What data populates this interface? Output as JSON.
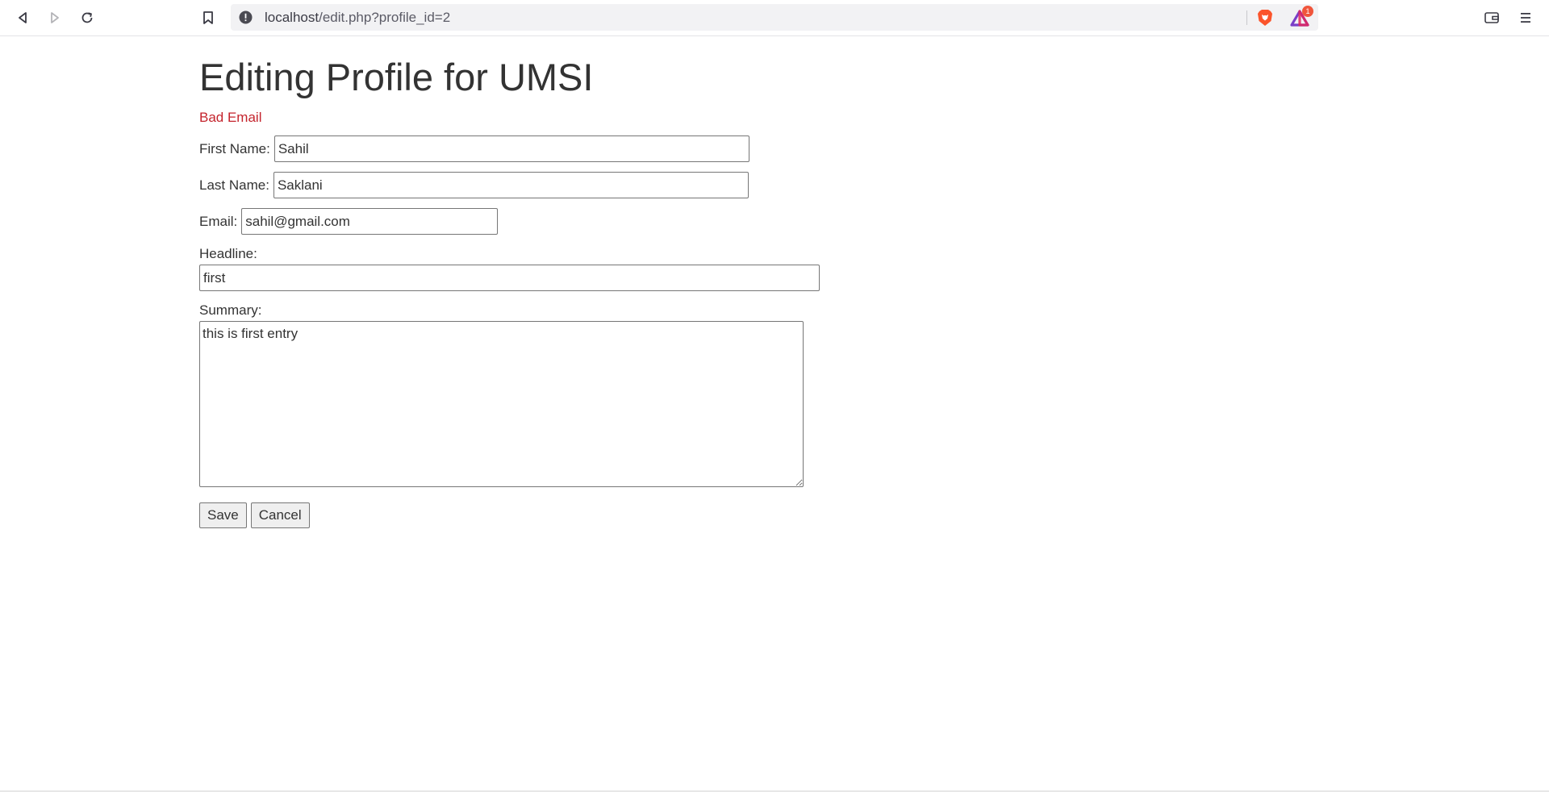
{
  "browser": {
    "url_host": "localhost",
    "url_path": "/edit.php?profile_id=2",
    "rewards_badge": "1",
    "icons": {
      "back": "back-arrow-icon",
      "forward": "forward-arrow-icon",
      "reload": "reload-icon",
      "bookmark": "bookmark-icon",
      "site_info": "not-secure-warning-icon",
      "shield": "brave-shield-icon",
      "rewards": "brave-rewards-icon",
      "wallet": "wallet-icon",
      "menu": "hamburger-menu-icon"
    }
  },
  "page": {
    "title": "Editing Profile for UMSI",
    "error": "Bad Email",
    "error_color": "#c4242d"
  },
  "form": {
    "first_name_label": "First Name:",
    "first_name_value": "Sahil",
    "last_name_label": "Last Name:",
    "last_name_value": "Saklani",
    "email_label": "Email:",
    "email_value": "sahil@gmail.com",
    "headline_label": "Headline:",
    "headline_value": "first",
    "summary_label": "Summary:",
    "summary_value": "this is first entry",
    "save_label": "Save",
    "cancel_label": "Cancel"
  }
}
